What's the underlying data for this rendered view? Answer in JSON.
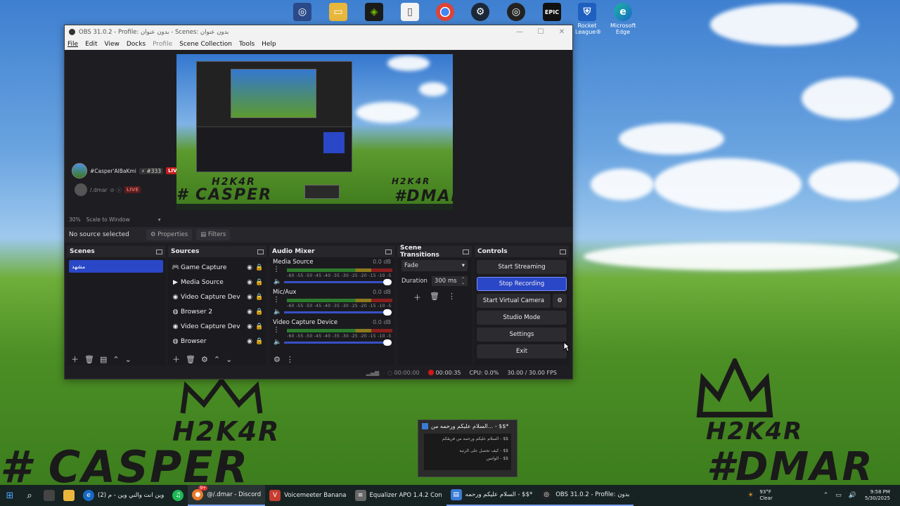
{
  "desktop": {
    "icons": [
      {
        "name": "search-app-icon",
        "label": ""
      },
      {
        "name": "folder-icon",
        "label": ""
      },
      {
        "name": "nvidia-icon",
        "label": ""
      },
      {
        "name": "file-icon",
        "label": ""
      },
      {
        "name": "chrome-icon",
        "label": ""
      },
      {
        "name": "steam-icon",
        "label": ""
      },
      {
        "name": "obs-desktop-icon",
        "label": ""
      },
      {
        "name": "epic-games-icon",
        "label": ""
      },
      {
        "name": "rocket-league-icon",
        "label": "Rocket League®"
      },
      {
        "name": "edge-icon",
        "label": "Microsoft Edge"
      }
    ],
    "epic_text": "EPIC",
    "watermark": {
      "left_top": "H2K4R",
      "left_bottom": "# CASPER",
      "right_top": "H2K4R",
      "right_bottom": "#DMAR"
    }
  },
  "obs": {
    "title": "OBS 31.0.2 - Profile: بدون عنوان - Scenes: بدون عنوان",
    "menu": [
      "File",
      "Edit",
      "View",
      "Docks",
      "Profile",
      "Scene Collection",
      "Tools",
      "Help"
    ],
    "overlay": {
      "user1": "#Casper'AlBaKmi",
      "user1_count": "⚡ #333",
      "live": "LIVE",
      "user2": "/.dmar",
      "live2": "LIVE"
    },
    "preview_labels": {
      "casper": "# CASPER",
      "h2k4r": "H2K4R",
      "h2k4r2": "H2K4R",
      "dmar": "#DMAR"
    },
    "zoom": "30%",
    "scale": "Scale to Window",
    "no_source": "No source selected",
    "properties": "Properties",
    "filters": "Filters",
    "scenes": {
      "title": "Scenes",
      "items": [
        "مشهد"
      ]
    },
    "sources": {
      "title": "Sources",
      "items": [
        {
          "icon": "🎮",
          "label": "Game Capture"
        },
        {
          "icon": "▶",
          "label": "Media Source"
        },
        {
          "icon": "◉",
          "label": "Video Capture Dev"
        },
        {
          "icon": "◍",
          "label": "Browser 2"
        },
        {
          "icon": "◉",
          "label": "Video Capture Dev"
        },
        {
          "icon": "◍",
          "label": "Browser"
        }
      ]
    },
    "mixer": {
      "title": "Audio Mixer",
      "ticks": "-60 -55 -50 -45 -40 -35 -30 -25 -20 -15 -10 -5 0",
      "channels": [
        {
          "name": "Media Source",
          "db": "0.0 dB"
        },
        {
          "name": "Mic/Aux",
          "db": "0.0 dB"
        },
        {
          "name": "Video Capture Device",
          "db": "0.0 dB"
        }
      ]
    },
    "transitions": {
      "title": "Scene Transitions",
      "type": "Fade",
      "duration_label": "Duration",
      "duration": "300 ms"
    },
    "controls": {
      "title": "Controls",
      "start_streaming": "Start Streaming",
      "stop_recording": "Stop Recording",
      "start_virtual_camera": "Start Virtual Camera",
      "studio_mode": "Studio Mode",
      "settings": "Settings",
      "exit": "Exit"
    },
    "status": {
      "stream_time": "00:00:00",
      "rec_time": "00:00:35",
      "cpu": "CPU: 0.0%",
      "fps": "30.00 / 30.00 FPS"
    }
  },
  "notification": {
    "title": "السلام عليكم ورحمه من... - $$*",
    "line1": "$$ - السلام عليكم ورحمه من فريقكم",
    "line2": "$$ - كيف تحصل على الرتبة",
    "line3": "$$ - الواتس"
  },
  "taskbar": {
    "items": [
      {
        "label": "(2) وين انت والني وين - م",
        "color": "#1769c4",
        "icon": "e"
      },
      {
        "label": "",
        "color": "#1db954",
        "icon": "♫"
      },
      {
        "label": "@/.dmar - Discord",
        "color": "#e87b2a",
        "icon": "●"
      },
      {
        "label": "Voicemeeter Banana",
        "color": "#c63d2f",
        "icon": "V"
      },
      {
        "label": "Equalizer APO 1.4.2 Con",
        "color": "#666",
        "icon": "≡"
      },
      {
        "label": "السلام عليكم ورحمه - $$*",
        "color": "#3a7bd5",
        "icon": "▤"
      },
      {
        "label": "OBS 31.0.2 - Profile: بدون",
        "color": "#222",
        "icon": "◎"
      }
    ],
    "discord_badge": "9+",
    "weather_temp": "93°F",
    "weather_desc": "Clear",
    "time": "9:58 PM",
    "date": "5/30/2025"
  }
}
